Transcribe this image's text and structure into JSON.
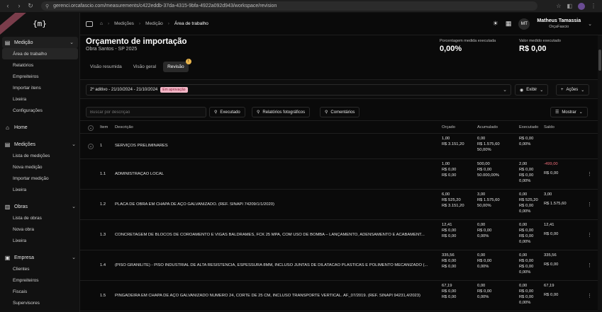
{
  "browser": {
    "url": "gerenci.orcafascio.com/measurements/c422eddb-37da-4315-9bfa-4922a092d943/workspace/revision"
  },
  "sidebar": {
    "logo": "{m}",
    "groups": [
      {
        "label": "Medição",
        "icon": "ruler-icon",
        "items": [
          "Área de trabalho",
          "Relatórios",
          "Empreiteiros",
          "Importar itens",
          "Lixeira",
          "Configurações"
        ]
      },
      {
        "label": "Home",
        "icon": "home-icon",
        "items": []
      },
      {
        "label": "Medições",
        "icon": "ruler-icon",
        "items": [
          "Lista de medições",
          "Nova medição",
          "Importar medição",
          "Lixeira"
        ]
      },
      {
        "label": "Obras",
        "icon": "building-icon",
        "items": [
          "Lista de obras",
          "Nova obra",
          "Lixeira"
        ]
      },
      {
        "label": "Empresa",
        "icon": "briefcase-icon",
        "items": [
          "Clientes",
          "Empreiteiros",
          "Fiscais",
          "Supervisores"
        ]
      }
    ]
  },
  "topbar": {
    "breadcrumb": [
      "Medições",
      "Medição",
      "Área de trabalho"
    ],
    "user_initials": "MT",
    "user_name": "Matheus Tamassia",
    "user_company": "OrçaFascio"
  },
  "header": {
    "title": "Orçamento de importação",
    "subtitle": "Obra Santos - SP 2025",
    "kpi_percent_label": "Porcentagem medida executada",
    "kpi_percent_value": "0,00%",
    "kpi_value_label": "Valor medido executado",
    "kpi_value_value": "R$ 0,00"
  },
  "tabs": [
    {
      "label": "Visão resumida",
      "active": false
    },
    {
      "label": "Visão geral",
      "active": false
    },
    {
      "label": "Revisão",
      "active": true,
      "badge": "!"
    }
  ],
  "revision": {
    "selected": "2º aditivo - 21/10/2024 - 21/10/2024",
    "status": "Em aprovação",
    "view_button": "Exibir",
    "actions_button": "Ações"
  },
  "toolbar": {
    "search_placeholder": "Buscar por descrição",
    "executed_filter": "Executado",
    "photo_reports": "Relatórios fotográficos",
    "comments": "Comentários",
    "show": "Mostrar"
  },
  "table": {
    "headers": {
      "item": "Item",
      "description": "Descrição",
      "budgeted": "Orçado",
      "accumulated": "Acumulado",
      "executed": "Executado",
      "balance": "Saldo"
    },
    "rows": [
      {
        "item": "1",
        "desc": "SERVIÇOS PRELIMINARES",
        "orcado": [
          "1,00",
          "R$ 3.151,20"
        ],
        "acumulado": [
          "0,00",
          "R$ 1.575,60",
          "50,00%"
        ],
        "executado": [
          "R$ 0,00",
          "0,00%"
        ],
        "saldo": [],
        "group": true,
        "negative_saldo": false
      },
      {
        "item": "1.1",
        "desc": "ADMINISTRAÇÃO LOCAL",
        "orcado": [
          "1,00",
          "R$ 0,00",
          "R$ 0,00"
        ],
        "acumulado": [
          "500,00",
          "R$ 0,00",
          "50.000,00%"
        ],
        "executado": [
          "2,00",
          "R$ 0,00",
          "R$ 0,00",
          "0,00%"
        ],
        "saldo": [
          "-499,00",
          "R$ 0,00"
        ],
        "group": false,
        "negative_saldo": true
      },
      {
        "item": "1.2",
        "desc": "PLACA DE OBRA EM CHAPA DE AÇO GALVANIZADO. (REF. SINAPI 74209/1/1/2020)",
        "orcado": [
          "6,00",
          "R$ 525,20",
          "R$ 3.151,20"
        ],
        "acumulado": [
          "3,00",
          "R$ 1.575,60",
          "50,00%"
        ],
        "executado": [
          "0,00",
          "R$ 525,20",
          "R$ 0,00",
          "0,00%"
        ],
        "saldo": [
          "3,00",
          "R$ 1.575,60"
        ],
        "group": false,
        "negative_saldo": false
      },
      {
        "item": "1.3",
        "desc": "CONCRETAGEM DE BLOCOS DE COROAMENTO E VIGAS BALDRAMES, FCK 25 MPA, COM USO DE BOMBA – LANÇAMENTO, ADENSAMENTO E ACABAMENT...",
        "orcado": [
          "12,41",
          "R$ 0,00",
          "R$ 0,00"
        ],
        "acumulado": [
          "0,00",
          "R$ 0,00",
          "0,00%"
        ],
        "executado": [
          "0,00",
          "R$ 0,00",
          "R$ 0,00",
          "0,00%"
        ],
        "saldo": [
          "12,41",
          "R$ 0,00"
        ],
        "group": false,
        "negative_saldo": false
      },
      {
        "item": "1.4",
        "desc": "(PISO GRANILITE) - PISO INDUSTRIAL DE ALTA RESISTENCIA, ESPESSURA 8MM, INCLUSO JUNTAS DE DILATACAO PLASTICAS E POLIMENTO MECANIZADO (...",
        "orcado": [
          "335,56",
          "R$ 0,00",
          "R$ 0,00"
        ],
        "acumulado": [
          "0,00",
          "R$ 0,00",
          "0,00%"
        ],
        "executado": [
          "0,00",
          "R$ 0,00",
          "R$ 0,00",
          "0,00%"
        ],
        "saldo": [
          "335,56",
          "R$ 0,00"
        ],
        "group": false,
        "negative_saldo": false
      },
      {
        "item": "1.5",
        "desc": "PINGADEIRA EM CHAPA DE AÇO GALVANIZADO NÚMERO 24, CORTE DE 25 CM, INCLUSO TRANSPORTE VERTICAL. AF_07/2019. (REF. SINAPI 94231,4/2023)",
        "orcado": [
          "67,19",
          "R$ 0,00",
          "R$ 0,00"
        ],
        "acumulado": [
          "0,00",
          "R$ 0,00",
          "0,00%"
        ],
        "executado": [
          "0,00",
          "R$ 0,00",
          "R$ 0,00",
          "0,00%"
        ],
        "saldo": [
          "67,19",
          "R$ 0,00"
        ],
        "group": false,
        "negative_saldo": false
      }
    ]
  }
}
